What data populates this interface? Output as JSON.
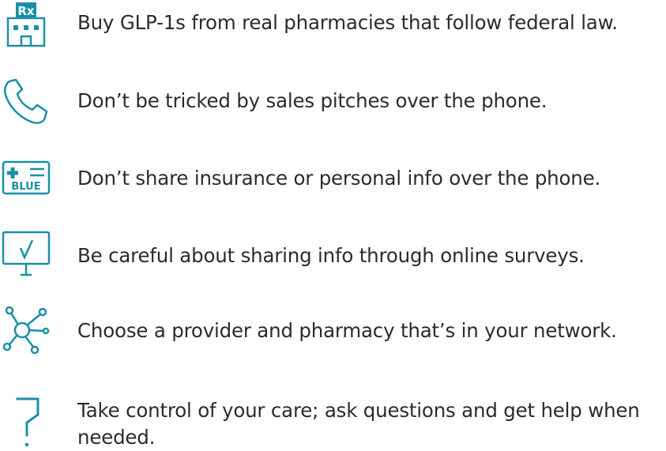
{
  "accent_color": "#1a8fa6",
  "tips": [
    {
      "icon": "pharmacy-rx-building-icon",
      "text": "Buy GLP-1s from real pharmacies that follow federal law."
    },
    {
      "icon": "phone-icon",
      "text": "Don’t be tricked by sales pitches over the phone."
    },
    {
      "icon": "insurance-card-icon",
      "text": "Don’t share insurance or personal info over the phone."
    },
    {
      "icon": "monitor-checkmark-icon",
      "text": "Be careful about sharing info through online surveys."
    },
    {
      "icon": "network-nodes-icon",
      "text": "Choose a provider and pharmacy that’s in your network."
    },
    {
      "icon": "question-mark-icon",
      "text": "Take control of your care; ask questions and get help when needed."
    }
  ],
  "insurance_card_label": "BLUE",
  "pharmacy_sign_label": "Rx"
}
